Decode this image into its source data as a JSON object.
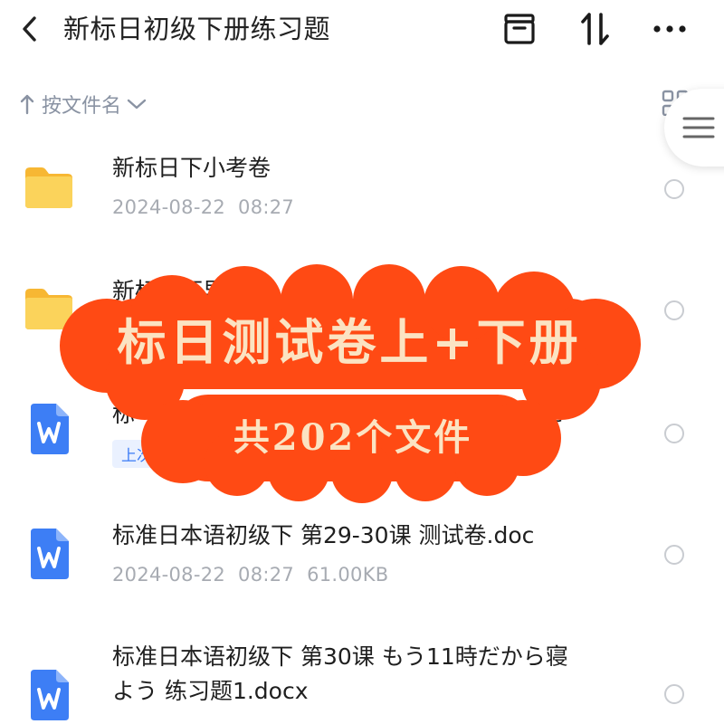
{
  "header": {
    "title": "新标日初级下册练习题",
    "icons": [
      "back-chevron-icon",
      "archive-icon",
      "sort-icon",
      "more-icon"
    ]
  },
  "sortbar": {
    "label": "按文件名"
  },
  "files": [
    {
      "name": "新标日下小考卷",
      "date": "2024-08-22",
      "time": "08:27",
      "size": "",
      "type": "folder"
    },
    {
      "name": "新标日下早测卷",
      "date": "",
      "time": "",
      "size": "",
      "type": "folder"
    },
    {
      "name": "标",
      "name_tail": "c",
      "tag": "上次",
      "type": "word"
    },
    {
      "name": "标准日本语初级下 第29-30课 测试卷.doc",
      "date": "2024-08-22",
      "time": "08:27",
      "size": "61.00KB",
      "type": "word"
    },
    {
      "name_line1": "标准日本语初级下 第30课 もう11時だから寝",
      "name_line2": "よう 练习题1.docx",
      "type": "word"
    }
  ],
  "banner": {
    "line1": "标日测试卷上+下册",
    "line2": "共202个文件"
  },
  "colors": {
    "banner_bg": "#ff4a14",
    "banner_text": "#fbe3c2",
    "folder": "#f9c84a",
    "word": "#3d7ef5",
    "meta_text": "#a7abb2"
  }
}
